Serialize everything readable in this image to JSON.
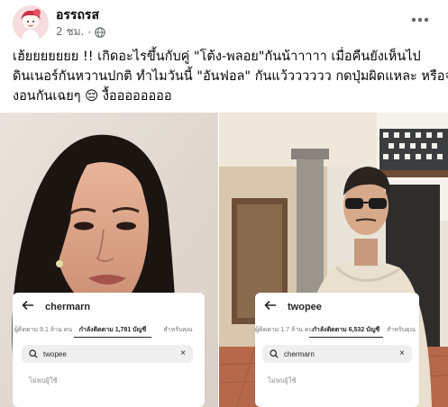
{
  "post": {
    "page_name": "อรรถรส",
    "time": "2 ชม.",
    "meta_separator": "·",
    "audience_icon": "globe-icon",
    "more_icon": "more-horizontal-icon",
    "text_lines": [
      "เฮ้ยยยยยยย !! เกิดอะไรขึ้นกับคู่ \"โต้ง-พลอย\"กันน้าาาาา เมื่อคืนยังเห็นไป",
      "ดินเนอร์กันหวานปกติ ทำไมวันนี้  \"อันฟอล\" กันแว้วววววว กดปุ่มผิดแหละ หรือจะ",
      "งอนกันเฉยๆ 😔 งื้ออออออออ"
    ]
  },
  "photos": {
    "left": {
      "card": {
        "back_icon": "arrow-left-icon",
        "username": "chermarn",
        "tabs": [
          "ผู้ติดตาม 9.1 ล้าน คน",
          "กำลังติดตาม 1,781 บัญชี",
          "สำหรับคุณ"
        ],
        "active_tab": 1,
        "search_value": "twopee",
        "search_icon": "search-icon",
        "clear_label": "×",
        "empty_text": "ไม่พบผู้ใช้"
      }
    },
    "right": {
      "card": {
        "back_icon": "arrow-left-icon",
        "username": "twopee",
        "tabs": [
          "ผู้ติดตาม 1.7 ล้าน คน",
          "กำลังติดตาม 6,532 บัญชี",
          "สำหรับคุณ"
        ],
        "active_tab": 1,
        "search_value": "chermarn",
        "search_icon": "search-icon",
        "clear_label": "×",
        "empty_text": "ไม่พบผู้ใช้"
      }
    }
  },
  "colors": {
    "text_primary": "#050505",
    "text_secondary": "#65676b",
    "ig_search_bg": "#efefef"
  }
}
